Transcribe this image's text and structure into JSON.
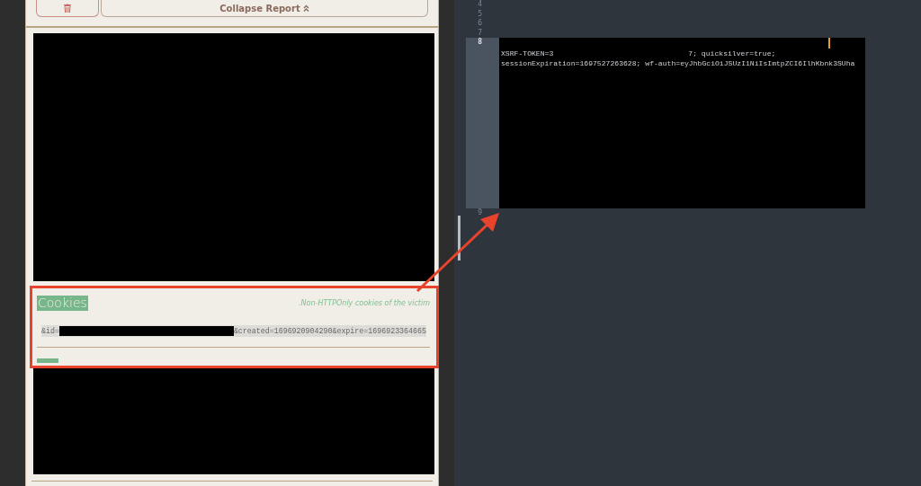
{
  "report_panel": {
    "collapse_button": {
      "label": "Collapse Report"
    },
    "cookies_section": {
      "title": "Cookies",
      "note": ".Non-HTTPOnly cookies of the victim",
      "value": [
        {
          "kind": "text",
          "text": "&id="
        },
        {
          "kind": "redacted"
        },
        {
          "kind": "text",
          "text": "&created=1696920904290&expire=1696923364665"
        }
      ]
    }
  },
  "editor": {
    "lines": [
      {
        "number": "4",
        "selected": false
      },
      {
        "number": "5",
        "selected": false
      },
      {
        "number": "6",
        "selected": false
      },
      {
        "number": "7",
        "selected": false
      },
      {
        "number": "8",
        "selected": true,
        "rows": [
          [
            {
              "kind": "redacted"
            }
          ],
          [
            {
              "kind": "text",
              "text": "XSRF-TOKEN=3"
            },
            {
              "kind": "redacted"
            },
            {
              "kind": "text",
              "text": "7; quicksilver=true;"
            }
          ],
          [
            {
              "kind": "text",
              "text": "sessionExpiration=1697527263628; wf-auth=eyJhbGciOiJSUzI1NiIsImtpZCI6IlhKbnk3SUha"
            }
          ]
        ]
      },
      {
        "number": "9",
        "selected": false
      }
    ]
  }
}
